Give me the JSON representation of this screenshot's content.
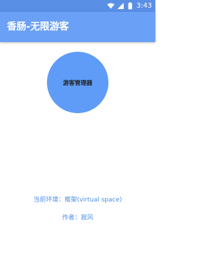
{
  "status_bar": {
    "time": "3:43",
    "icons": [
      "wifi-icon",
      "cellular-signal-icon",
      "battery-icon"
    ]
  },
  "app_bar": {
    "title": "香肠-无限游客"
  },
  "main": {
    "manager_button_label": "游客管理器",
    "environment_text": "当前环境：框架(virtual space)",
    "author_text": "作者：寂风"
  },
  "colors": {
    "status_bar": "#5a8fe6",
    "app_bar": "#6aa0f5",
    "button": "#5e9cf7",
    "accent_text": "#4a8ee8"
  }
}
